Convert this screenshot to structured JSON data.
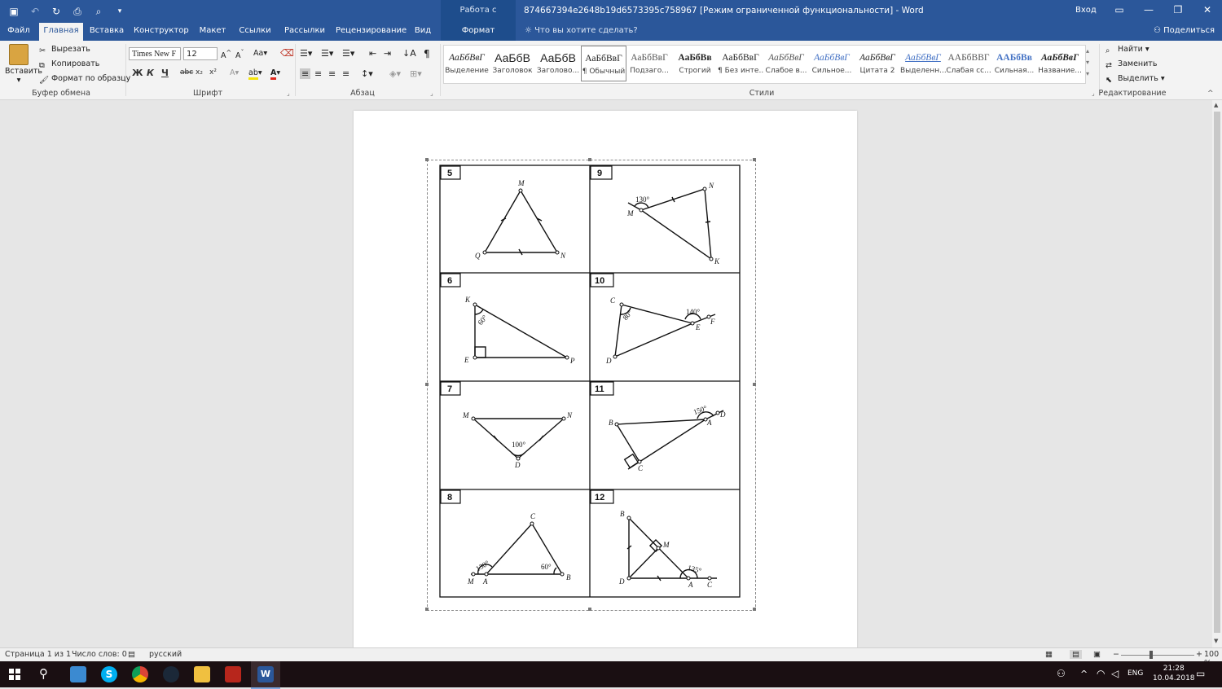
{
  "titlebar": {
    "context_group": "Работа с рисунками",
    "document_title": "874667394e2648b19d6573395c758967 [Режим ограниченной функциональности]  -  Word",
    "sign_in": "Вход"
  },
  "tabs": [
    "Файл",
    "Главная",
    "Вставка",
    "Конструктор",
    "Макет",
    "Ссылки",
    "Рассылки",
    "Рецензирование",
    "Вид",
    "Формат"
  ],
  "active_tab": "Главная",
  "tell_me": "Что вы хотите сделать?",
  "share": "Поделиться",
  "clipboard": {
    "paste": "Вставить",
    "cut": "Вырезать",
    "copy": "Копировать",
    "format_painter": "Формат по образцу",
    "label": "Буфер обмена"
  },
  "font": {
    "name": "Times New F",
    "size": "12",
    "label": "Шрифт",
    "bold": "Ж",
    "italic": "К",
    "underline": "Ч",
    "strike": "abc",
    "sub": "x₂",
    "sup": "x²",
    "case": "Aa"
  },
  "paragraph": {
    "label": "Абзац",
    "pilcrow": "¶"
  },
  "styles": {
    "label": "Стили",
    "items": [
      {
        "preview": "АаБбВвГ",
        "name": "Выделение"
      },
      {
        "preview": "АаБбВ",
        "name": "Заголовок"
      },
      {
        "preview": "АаБбВ",
        "name": "Заголово..."
      },
      {
        "preview": "АаБбВвГ",
        "name": "¶ Обычный"
      },
      {
        "preview": "АаБбВвГ",
        "name": "Подзаго..."
      },
      {
        "preview": "АаБбВв",
        "name": "Строгий"
      },
      {
        "preview": "АаБбВвГ",
        "name": "¶ Без инте..."
      },
      {
        "preview": "АаБбВвГ",
        "name": "Слабое в..."
      },
      {
        "preview": "АаБбВвГ",
        "name": "Сильное..."
      },
      {
        "preview": "АаБбВвГ",
        "name": "Цитата 2"
      },
      {
        "preview": "АаБбВвГ",
        "name": "Выделенн..."
      },
      {
        "preview": "ААБбВВГ",
        "name": "Слабая сс..."
      },
      {
        "preview": "ААБбВв",
        "name": "Сильная..."
      },
      {
        "preview": "АаБбВвГ",
        "name": "Название..."
      }
    ]
  },
  "editing": {
    "find": "Найти",
    "replace": "Заменить",
    "select": "Выделить",
    "label": "Редактирование"
  },
  "figure": {
    "cells": [
      {
        "num": "5",
        "labels": {
          "M": "M",
          "Q": "Q",
          "N": "N"
        }
      },
      {
        "num": "9",
        "labels": {
          "N": "N",
          "M": "M",
          "K": "K",
          "angle": "130°"
        }
      },
      {
        "num": "6",
        "labels": {
          "K": "K",
          "E": "E",
          "P": "P",
          "angle": "60°"
        }
      },
      {
        "num": "10",
        "labels": {
          "C": "C",
          "D": "D",
          "E": "E",
          "F": "F",
          "angle1": "80°",
          "angle2": "140°"
        }
      },
      {
        "num": "7",
        "labels": {
          "M": "M",
          "N": "N",
          "D": "D",
          "angle": "100°"
        }
      },
      {
        "num": "11",
        "labels": {
          "B": "B",
          "A": "A",
          "D": "D",
          "C": "C",
          "angle": "150°"
        }
      },
      {
        "num": "8",
        "labels": {
          "C": "C",
          "M": "M",
          "A": "A",
          "B": "B",
          "angle1": "130°",
          "angle2": "60°"
        }
      },
      {
        "num": "12",
        "labels": {
          "B": "B",
          "M": "M",
          "D": "D",
          "A": "A",
          "C": "C",
          "angle": "135°"
        }
      }
    ]
  },
  "statusbar": {
    "page": "Страница 1 из 1",
    "words": "Число слов: 0",
    "language": "русский",
    "zoom": "100 %"
  },
  "taskbar": {
    "lang": "ENG",
    "time": "21:28",
    "date": "10.04.2018"
  }
}
